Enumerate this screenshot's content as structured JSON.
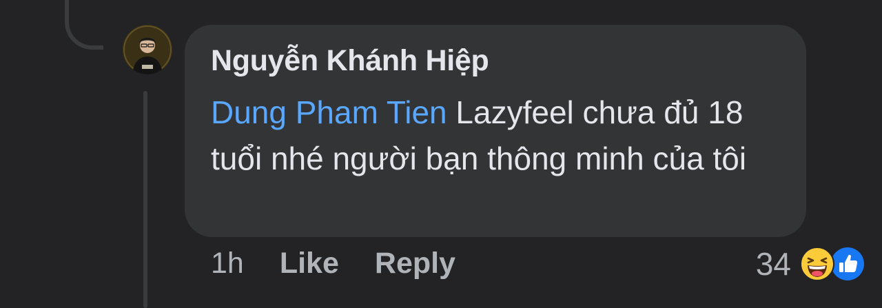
{
  "comment": {
    "author": "Nguyễn Khánh Hiệp",
    "mention": "Dung Pham Tien",
    "text": " Lazyfeel chưa đủ 18 tuổi nhé người bạn thông minh của tôi"
  },
  "actions": {
    "time": "1h",
    "like_label": "Like",
    "reply_label": "Reply"
  },
  "reactions": {
    "count": "34",
    "icons": [
      "haha-icon",
      "like-icon"
    ]
  },
  "colors": {
    "background": "#232325",
    "bubble": "#333436",
    "mention": "#5aa7ff",
    "text": "#e4e6eb",
    "muted": "#b0b3b8",
    "like_blue": "#1877f2",
    "haha_yellow": "#fbcb3a"
  }
}
